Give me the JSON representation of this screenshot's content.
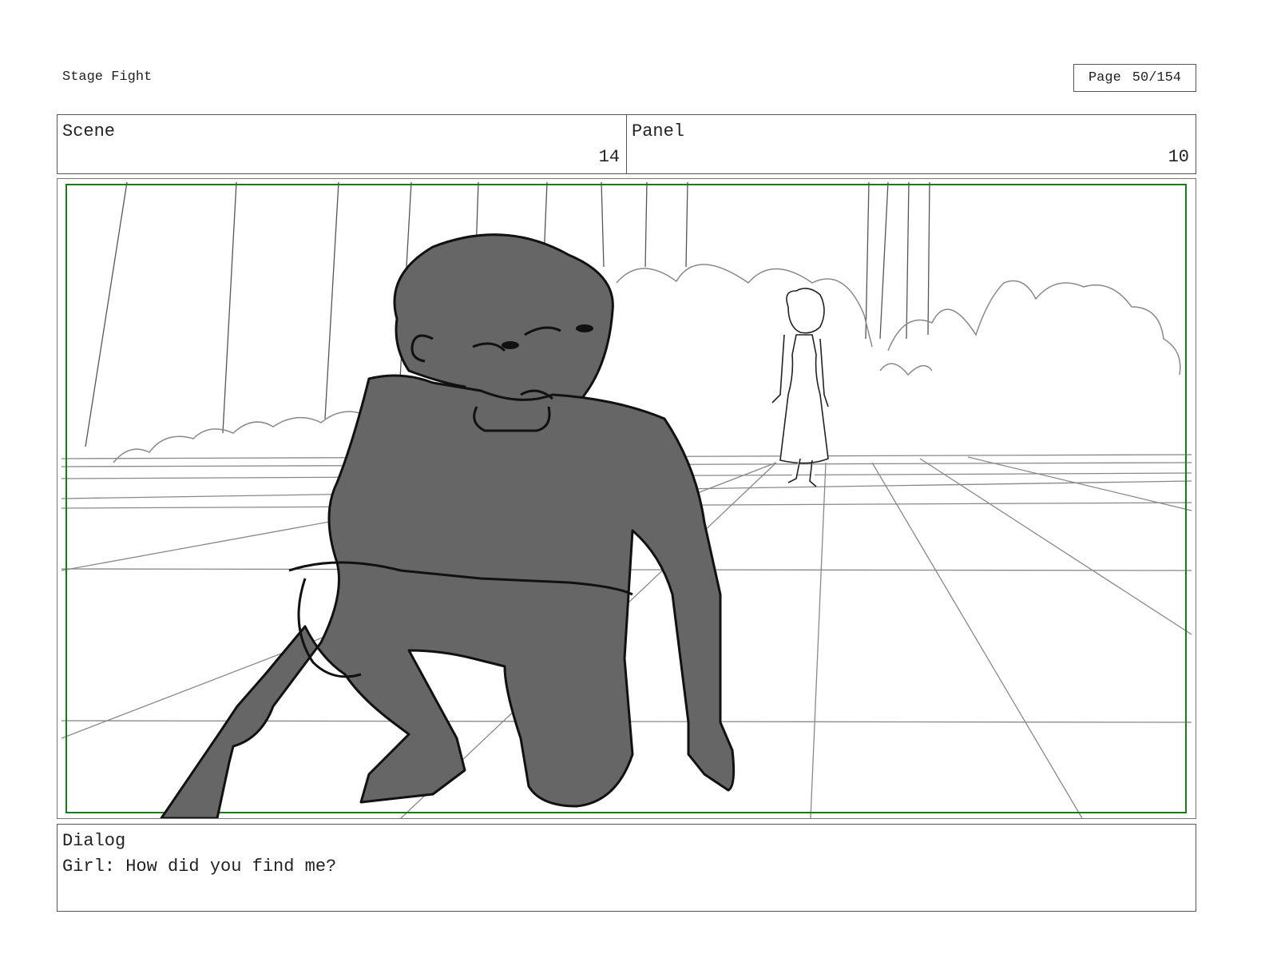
{
  "header": {
    "project_title": "Stage Fight",
    "page_label": "Page",
    "page_number": "50/154"
  },
  "scene": {
    "label": "Scene",
    "value": "14"
  },
  "panel": {
    "label": "Panel",
    "value": "10"
  },
  "dialog": {
    "label": "Dialog",
    "text": "Girl: How did you find me?"
  },
  "colors": {
    "safe_frame": "#1a7a1a",
    "figure_fill": "#666666",
    "line": "#111111",
    "sketch": "#888888"
  }
}
